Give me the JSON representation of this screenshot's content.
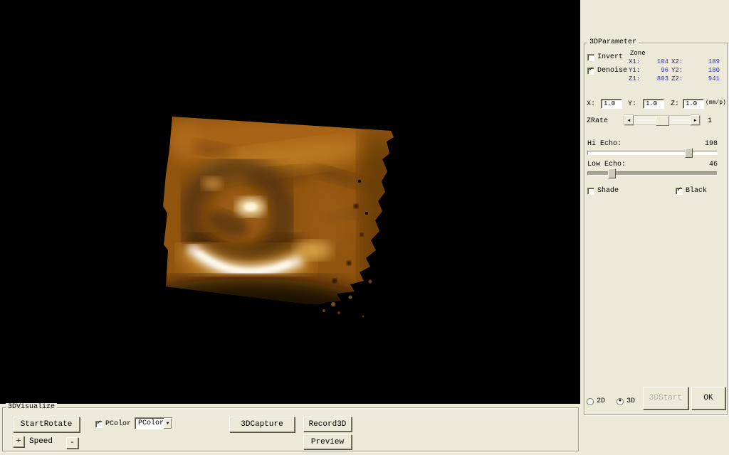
{
  "palette": {
    "window_bg": "#ece9d8",
    "viewport_bg": "#000000",
    "value_text": "#3434bb",
    "volume_base": "#91540f",
    "volume_highlight": "#ffffff"
  },
  "parameter_panel": {
    "title": "3DParameter",
    "invert": {
      "label": "Invert",
      "checked": false,
      "mark": ""
    },
    "denoise": {
      "label": "Denoise",
      "checked": true,
      "mark": "✓"
    },
    "zone": {
      "label": "Zone",
      "rows": [
        {
          "l1": "X1:",
          "v1": "104",
          "l2": "X2:",
          "v2": "189"
        },
        {
          "l1": "Y1:",
          "v1": "96",
          "l2": "Y2:",
          "v2": "180"
        },
        {
          "l1": "Z1:",
          "v1": "803",
          "l2": "Z2:",
          "v2": "941"
        }
      ]
    },
    "scale": {
      "x_label": "X:",
      "x_value": "1.0",
      "y_label": "Y:",
      "y_value": "1.0",
      "z_label": "Z:",
      "z_value": "1.0",
      "unit": "(mm/p)"
    },
    "zrate": {
      "label": "ZRate",
      "value": "1",
      "left_arrow": "◄",
      "right_arrow": "►"
    },
    "hi_echo": {
      "label": "Hi Echo:",
      "value": "198"
    },
    "low_echo": {
      "label": "Low Echo:",
      "value": "46"
    },
    "shade": {
      "label": "Shade",
      "checked": false,
      "mark": ""
    },
    "black": {
      "label": "Black",
      "checked": true,
      "mark": "✓"
    },
    "mode_2d": {
      "label": "2D",
      "selected": false,
      "dot": ""
    },
    "mode_3d": {
      "label": "3D",
      "selected": true,
      "dot": "●"
    },
    "start_button": "3DStart",
    "ok_button": "OK"
  },
  "visualize_panel": {
    "title": "3DVisualize",
    "start_rotate_button": "StartRotate",
    "pcolor_checkbox": {
      "label": "PColor",
      "checked": true,
      "mark": "✓"
    },
    "pcolor_dropdown": {
      "value": "PColor",
      "arrow": "▼"
    },
    "capture_button": "3DCapture",
    "record_button": "Record3D",
    "preview_button": "Preview",
    "speed": {
      "plus": "+",
      "label": "Speed",
      "minus": "-"
    }
  }
}
